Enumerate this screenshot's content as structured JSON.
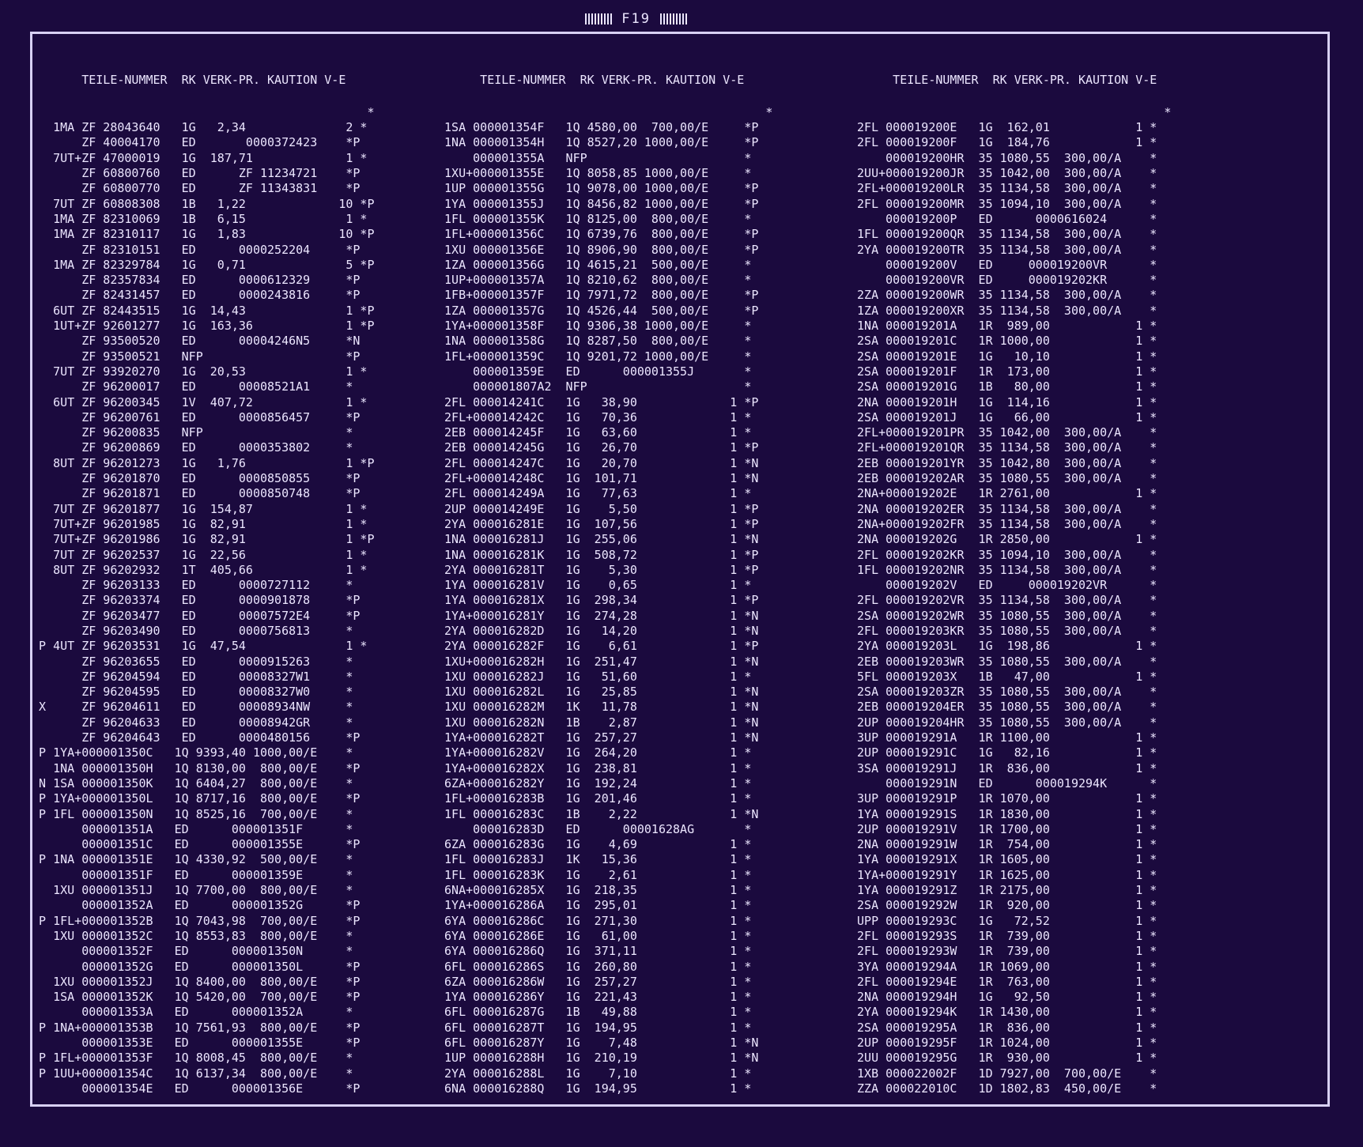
{
  "sheet": {
    "title": "F19"
  },
  "columns": [
    {
      "header": "       TEILE-NUMMER  RK VERK-PR. KAUTION V-E",
      "rows": [
        "                                               *",
        "   1MA ZF 28043640   1G   2,34              2 *",
        "       ZF 40004170   ED       0000372423    *P",
        "   7UT+ZF 47000019   1G  187,71             1 *",
        "       ZF 60800760   ED      ZF 11234721    *P",
        "       ZF 60800770   ED      ZF 11343831    *P",
        "   7UT ZF 60808308   1B   1,22             10 *P",
        "   1MA ZF 82310069   1B   6,15              1 *",
        "   1MA ZF 82310117   1G   1,83             10 *P",
        "       ZF 82310151   ED      0000252204     *P",
        "   1MA ZF 82329784   1G   0,71              5 *P",
        "       ZF 82357834   ED      0000612329     *P",
        "       ZF 82431457   ED      0000243816     *P",
        "   6UT ZF 82443515   1G  14,43              1 *P",
        "   1UT+ZF 92601277   1G  163,36             1 *P",
        "       ZF 93500520   ED      00004246N5     *N",
        "       ZF 93500521   NFP                    *P",
        "   7UT ZF 93920270   1G  20,53              1 *",
        "       ZF 96200017   ED      00008521A1     *",
        "   6UT ZF 96200345   1V  407,72             1 *",
        "       ZF 96200761   ED      0000856457     *P",
        "       ZF 96200835   NFP                    *",
        "       ZF 96200869   ED      0000353802     *",
        "   8UT ZF 96201273   1G   1,76              1 *P",
        "       ZF 96201870   ED      0000850855     *P",
        "       ZF 96201871   ED      0000850748     *P",
        "   7UT ZF 96201877   1G  154,87             1 *",
        "   7UT+ZF 96201985   1G  82,91              1 *",
        "   7UT+ZF 96201986   1G  82,91              1 *P",
        "   7UT ZF 96202537   1G  22,56              1 *",
        "   8UT ZF 96202932   1T  405,66             1 *",
        "       ZF 96203133   ED      0000727112     *",
        "       ZF 96203374   ED      0000901878     *P",
        "       ZF 96203477   ED      00007572E4     *P",
        "       ZF 96203490   ED      0000756813     *",
        " P 4UT ZF 96203531   1G  47,54              1 *",
        "       ZF 96203655   ED      0000915263     *",
        "       ZF 96204594   ED      00008327W1     *",
        "       ZF 96204595   ED      00008327W0     *",
        " X     ZF 96204611   ED      00008934NW     *",
        "       ZF 96204633   ED      00008942GR     *",
        "       ZF 96204643   ED      0000480156     *P",
        " P 1YA+000001350C   1Q 9393,40 1000,00/E    *",
        "   1NA 000001350H   1Q 8130,00  800,00/E    *P",
        " N 1SA 000001350K   1Q 6404,27  800,00/E    *",
        " P 1YA+000001350L   1Q 8717,16  800,00/E    *P",
        " P 1FL 000001350N   1Q 8525,16  700,00/E    *",
        "       000001351A   ED      000001351F      *",
        "       000001351C   ED      000001355E      *P",
        " P 1NA 000001351E   1Q 4330,92  500,00/E    *",
        "       000001351F   ED      000001359E      *",
        "   1XU 000001351J   1Q 7700,00  800,00/E    *",
        "       000001352A   ED      000001352G      *P",
        " P 1FL+000001352B   1Q 7043,98  700,00/E    *P",
        "   1XU 000001352C   1Q 8553,83  800,00/E    *",
        "       000001352F   ED      000001350N      *",
        "       000001352G   ED      000001350L      *P",
        "   1XU 000001352J   1Q 8400,00  800,00/E    *P",
        "   1SA 000001352K   1Q 5420,00  700,00/E    *P",
        "       000001353A   ED      000001352A      *",
        " P 1NA+000001353B   1Q 7561,93  800,00/E    *P",
        "       000001353E   ED      000001355E      *P",
        " P 1FL+000001353F   1Q 8008,45  800,00/E    *",
        " P 1UU+000001354C   1Q 6137,34  800,00/E    *",
        "       000001354E   ED      000001356E      *P"
      ]
    },
    {
      "header": "      TEILE-NUMMER  RK VERK-PR. KAUTION V-E",
      "rows": [
        "                                              *",
        " 1SA 000001354F   1Q 4580,00  700,00/E     *P",
        " 1NA 000001354H   1Q 8527,20 1000,00/E     *P",
        "     000001355A   NFP                      *",
        " 1XU+000001355E   1Q 8058,85 1000,00/E     *",
        " 1UP 000001355G   1Q 9078,00 1000,00/E     *P",
        " 1YA 000001355J   1Q 8456,82 1000,00/E     *P",
        " 1FL 000001355K   1Q 8125,00  800,00/E     *",
        " 1FL+000001356C   1Q 6739,76  800,00/E     *P",
        " 1XU 000001356E   1Q 8906,90  800,00/E     *P",
        " 1ZA 000001356G   1Q 4615,21  500,00/E     *",
        " 1UP+000001357A   1Q 8210,62  800,00/E     *",
        " 1FB+000001357F   1Q 7971,72  800,00/E     *P",
        " 1ZA 000001357G   1Q 4526,44  500,00/E     *P",
        " 1YA+000001358F   1Q 9306,38 1000,00/E     *",
        " 1NA 000001358G   1Q 8287,50  800,00/E     *",
        " 1FL+000001359C   1Q 9201,72 1000,00/E     *",
        "     000001359E   ED      000001355J       *",
        "     000001807A2  NFP                      *",
        " 2FL 000014241C   1G   38,90             1 *P",
        " 2FL+000014242C   1G   70,36             1 *",
        " 2EB 000014245F   1G   63,60             1 *",
        " 2EB 000014245G   1G   26,70             1 *P",
        " 2FL 000014247C   1G   20,70             1 *N",
        " 2FL+000014248C   1G  101,71             1 *N",
        " 2FL 000014249A   1G   77,63             1 *",
        " 2UP 000014249E   1G    5,50             1 *P",
        " 2YA 000016281E   1G  107,56             1 *P",
        " 1NA 000016281J   1G  255,06             1 *N",
        " 1NA 000016281K   1G  508,72             1 *P",
        " 2YA 000016281T   1G    5,30             1 *P",
        " 1YA 000016281V   1G    0,65             1 *",
        " 1YA 000016281X   1G  298,34             1 *P",
        " 1YA+000016281Y   1G  274,28             1 *N",
        " 2YA 000016282D   1G   14,20             1 *N",
        " 2YA 000016282F   1G    6,61             1 *P",
        " 1XU+000016282H   1G  251,47             1 *N",
        " 1XU 000016282J   1G   51,60             1 *",
        " 1XU 000016282L   1G   25,85             1 *N",
        " 1XU 000016282M   1K   11,78             1 *N",
        " 1XU 000016282N   1B    2,87             1 *N",
        " 1YA+000016282T   1G  257,27             1 *N",
        " 1YA+000016282V   1G  264,20             1 *",
        " 1YA+000016282X   1G  238,81             1 *",
        " 6ZA+000016282Y   1G  192,24             1 *",
        " 1FL+000016283B   1G  201,46             1 *",
        " 1FL 000016283C   1B    2,22             1 *N",
        "     000016283D   ED      00001628AG       *",
        " 6ZA 000016283G   1G    4,69             1 *",
        " 1FL 000016283J   1K   15,36             1 *",
        " 1FL 000016283K   1G    2,61             1 *",
        " 6NA+000016285X   1G  218,35             1 *",
        " 1YA+000016286A   1G  295,01             1 *",
        " 6YA 000016286C   1G  271,30             1 *",
        " 6YA 000016286E   1G   61,00             1 *",
        " 6YA 000016286Q   1G  371,11             1 *",
        " 6FL 000016286S   1G  260,80             1 *",
        " 6ZA 000016286W   1G  257,27             1 *",
        " 1YA 000016286Y   1G  221,43             1 *",
        " 6FL 000016287G   1B   49,88             1 *",
        " 6FL 000016287T   1G  194,95             1 *",
        " 6FL 000016287Y   1G    7,48             1 *N",
        " 1UP 000016288H   1G  210,19             1 *N",
        " 2YA 000016288L   1G    7,10             1 *",
        " 6NA 000016288Q   1G  194,95             1 *"
      ]
    },
    {
      "header": "      TEILE-NUMMER  RK VERK-PR. KAUTION V-E",
      "rows": [
        "                                            *",
        " 2FL 000019200E   1G  162,01            1 *",
        " 2FL 000019200F   1G  184,76            1 *",
        "     000019200HR  35 1080,55  300,00/A    *",
        " 2UU+000019200JR  35 1042,00  300,00/A    *",
        " 2FL+000019200LR  35 1134,58  300,00/A    *",
        " 2FL 000019200MR  35 1094,10  300,00/A    *",
        "     000019200P   ED      0000616024      *",
        " 1FL 000019200QR  35 1134,58  300,00/A    *",
        " 2YA 000019200TR  35 1134,58  300,00/A    *",
        "     000019200V   ED     000019200VR      *",
        "     000019200VR  ED     000019202KR      *",
        " 2ZA 000019200WR  35 1134,58  300,00/A    *",
        " 1ZA 000019200XR  35 1134,58  300,00/A    *",
        " 1NA 000019201A   1R  989,00            1 *",
        " 2SA 000019201C   1R 1000,00            1 *",
        " 2SA 000019201E   1G   10,10            1 *",
        " 2SA 000019201F   1R  173,00            1 *",
        " 2SA 000019201G   1B   80,00            1 *",
        " 2NA 000019201H   1G  114,16            1 *",
        " 2SA 000019201J   1G   66,00            1 *",
        " 2FL+000019201PR  35 1042,00  300,00/A    *",
        " 2FL+000019201QR  35 1134,58  300,00/A    *",
        " 2EB 000019201YR  35 1042,80  300,00/A    *",
        " 2EB 000019202AR  35 1080,55  300,00/A    *",
        " 2NA+000019202E   1R 2761,00            1 *",
        " 2NA 000019202ER  35 1134,58  300,00/A    *",
        " 2NA+000019202FR  35 1134,58  300,00/A    *",
        " 2NA 000019202G   1R 2850,00            1 *",
        " 2FL 000019202KR  35 1094,10  300,00/A    *",
        " 1FL 000019202NR  35 1134,58  300,00/A    *",
        "     000019202V   ED     000019202VR      *",
        " 2FL 000019202VR  35 1134,58  300,00/A    *",
        " 2SA 000019202WR  35 1080,55  300,00/A    *",
        " 2FL 000019203KR  35 1080,55  300,00/A    *",
        " 2YA 000019203L   1G  198,86            1 *",
        " 2EB 000019203WR  35 1080,55  300,00/A    *",
        " 5FL 000019203X   1B   47,00            1 *",
        " 2SA 000019203ZR  35 1080,55  300,00/A    *",
        " 2EB 000019204ER  35 1080,55  300,00/A    *",
        " 2UP 000019204HR  35 1080,55  300,00/A    *",
        " 3UP 000019291A   1R 1100,00            1 *",
        " 2UP 000019291C   1G   82,16            1 *",
        " 3SA 000019291J   1R  836,00            1 *",
        "     000019291N   ED      000019294K      *",
        " 3UP 000019291P   1R 1070,00            1 *",
        " 1YA 000019291S   1R 1830,00            1 *",
        " 2UP 000019291V   1R 1700,00            1 *",
        " 2NA 000019291W   1R  754,00            1 *",
        " 1YA 000019291X   1R 1605,00            1 *",
        " 1YA+000019291Y   1R 1625,00            1 *",
        " 1YA 000019291Z   1R 2175,00            1 *",
        " 2SA 000019292W   1R  920,00            1 *",
        " UPP 000019293C   1G   72,52            1 *",
        " 2FL 000019293S   1R  739,00            1 *",
        " 2FL 000019293W   1R  739,00            1 *",
        " 3YA 000019294A   1R 1069,00            1 *",
        " 2FL 000019294E   1R  763,00            1 *",
        " 2NA 000019294H   1G   92,50            1 *",
        " 2YA 000019294K   1R 1430,00            1 *",
        " 2SA 000019295A   1R  836,00            1 *",
        " 2UP 000019295F   1R 1024,00            1 *",
        " 2UU 000019295G   1R  930,00            1 *",
        " 1XB 000022002F   1D 7927,00  700,00/E    *",
        " ZZA 000022010C   1D 1802,83  450,00/E    *"
      ]
    }
  ]
}
